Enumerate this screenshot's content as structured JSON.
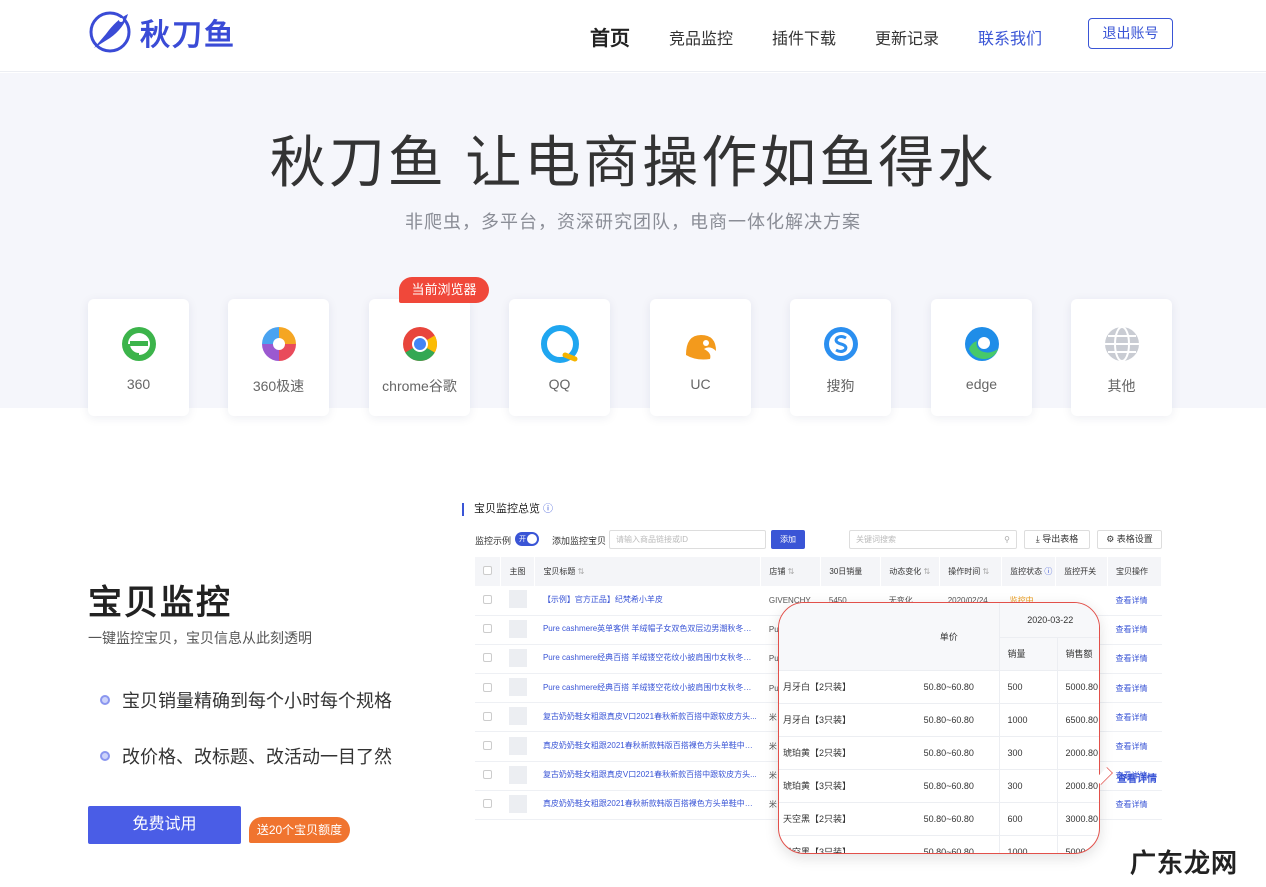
{
  "header": {
    "brand": "秋刀鱼",
    "nav": [
      "首页",
      "竞品监控",
      "插件下载",
      "更新记录",
      "联系我们"
    ],
    "logout_label": "退出账号"
  },
  "hero": {
    "title": "秋刀鱼 让电商操作如鱼得水",
    "subtitle": "非爬虫，多平台，资深研究团队，电商一体化解决方案",
    "current_browser_badge": "当前浏览器",
    "browsers": [
      {
        "label": "360",
        "icon": "360-browser-icon"
      },
      {
        "label": "360极速",
        "icon": "360-speed-browser-icon"
      },
      {
        "label": "chrome谷歌",
        "icon": "chrome-icon"
      },
      {
        "label": "QQ",
        "icon": "qq-browser-icon"
      },
      {
        "label": "UC",
        "icon": "uc-browser-icon"
      },
      {
        "label": "搜狗",
        "icon": "sogou-browser-icon"
      },
      {
        "label": "edge",
        "icon": "edge-icon"
      },
      {
        "label": "其他",
        "icon": "globe-icon"
      }
    ]
  },
  "feature": {
    "title": "宝贝监控",
    "subtitle": "一键监控宝贝，宝贝信息从此刻透明",
    "bullets": [
      "宝贝销量精确到每个小时每个规格",
      "改价格、改标题、改活动一目了然"
    ],
    "trial_label": "免费试用",
    "trial_badge": "送20个宝贝额度"
  },
  "dashboard": {
    "title": "宝贝监控总览",
    "monitor_example_label": "监控示例",
    "toggle_text": "开",
    "add_label": "添加监控宝贝",
    "add_placeholder": "请输入商品链接或ID",
    "add_button": "添加",
    "keyword_placeholder": "关键词搜索",
    "export_label": "导出表格",
    "settings_label": "表格设置",
    "columns": [
      "主图",
      "宝贝标题",
      "店铺",
      "30日销量",
      "动态变化",
      "操作时间",
      "监控状态",
      "监控开关",
      "宝贝操作"
    ],
    "rows": [
      {
        "title": "【示例】官方正品】纪梵希小羊皮",
        "shop": "GIVENCHY",
        "sales": "5450",
        "change": "无变化",
        "time": "2020/02/24",
        "status": "监控中",
        "action": "查看详情"
      },
      {
        "title": "Pure cashmere英单客供 羊绒帽子女双色双层边男潮秋冬季...",
        "shop": "Pu",
        "sales": "",
        "change": "",
        "time": "",
        "status": "",
        "action": "查看详情"
      },
      {
        "title": "Pure cashmere经典百搭 羊绒镂空花纹小披肩围巾女秋冬季...",
        "shop": "Pu",
        "sales": "",
        "change": "",
        "time": "",
        "status": "",
        "action": "查看详情"
      },
      {
        "title": "Pure cashmere经典百搭 羊绒镂空花纹小披肩围巾女秋冬季...",
        "shop": "Pu",
        "sales": "",
        "change": "",
        "time": "",
        "status": "",
        "action": "查看详情"
      },
      {
        "title": "复古奶奶鞋女粗跟真皮V口2021春秋新款百搭中跟软皮方头...",
        "shop": "米",
        "sales": "",
        "change": "",
        "time": "",
        "status": "",
        "action": "查看详情"
      },
      {
        "title": "真皮奶奶鞋女粗跟2021春秋新款韩版百搭裸色方头单鞋中跟...",
        "shop": "米",
        "sales": "",
        "change": "",
        "time": "",
        "status": "",
        "action": "查看详情"
      },
      {
        "title": "复古奶奶鞋女粗跟真皮V口2021春秋新款百搭中跟软皮方头...",
        "shop": "米",
        "sales": "",
        "change": "",
        "time": "",
        "status": "",
        "action": "查看详情"
      },
      {
        "title": "真皮奶奶鞋女粗跟2021春秋新款韩版百搭裸色方头单鞋中跟...",
        "shop": "米",
        "sales": "",
        "change": "",
        "time": "",
        "status": "",
        "action": "查看详情"
      }
    ]
  },
  "popup": {
    "price_header": "单价",
    "date": "2020-03-22",
    "qty_header": "销量",
    "amount_header": "销售额",
    "rows": [
      {
        "spec": "月牙白【2只装】",
        "price": "50.80~60.80",
        "qty": "500",
        "amount": "5000.80"
      },
      {
        "spec": "月牙白【3只装】",
        "price": "50.80~60.80",
        "qty": "1000",
        "amount": "6500.80"
      },
      {
        "spec": "琥珀黄【2只装】",
        "price": "50.80~60.80",
        "qty": "300",
        "amount": "2000.80"
      },
      {
        "spec": "琥珀黄【3只装】",
        "price": "50.80~60.80",
        "qty": "300",
        "amount": "2000.80"
      },
      {
        "spec": "天空黑【2只装】",
        "price": "50.80~60.80",
        "qty": "600",
        "amount": "3000.80"
      },
      {
        "spec": "天空黑【3只装】",
        "price": "50.80~60.80",
        "qty": "1000",
        "amount": "5000"
      }
    ],
    "detail_link": "查看详情"
  },
  "watermark": "广东龙网",
  "colors": {
    "brand": "#3a55d6",
    "badge_red": "#f0483a",
    "badge_orange": "#f0742f",
    "hero_bg": "#f5f6fb"
  }
}
